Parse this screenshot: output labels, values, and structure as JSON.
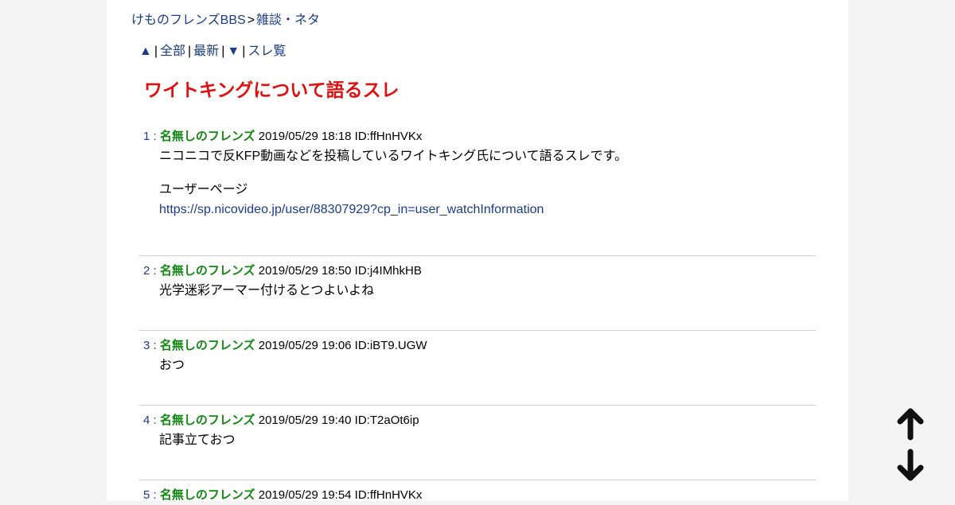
{
  "breadcrumb": {
    "board_link": "けものフレンズBBS",
    "separator": ">",
    "category_link": "雑談・ネタ"
  },
  "nav": {
    "up_arrow": "▲",
    "all": "全部",
    "latest": "最新",
    "down_arrow": "▼",
    "thread_list": "スレ覧",
    "separator": "|"
  },
  "thread_title": "ワイトキングについて語るスレ",
  "posts": [
    {
      "number": "1 :",
      "name": "名無しのフレンズ",
      "meta": "2019/05/29 18:18 ID:ffHnHVKx",
      "body_line1": "ニコニコで反KFP動画などを投稿しているワイトキング氏について語るスレです。",
      "body_line2": "ユーザーページ",
      "body_link": "https://sp.nicovideo.jp/user/88307929?cp_in=user_watchInformation"
    },
    {
      "number": "2 :",
      "name": "名無しのフレンズ",
      "meta": "2019/05/29 18:50 ID:j4IMhkHB",
      "body_line1": "光学迷彩アーマー付けるとつよいよね"
    },
    {
      "number": "3 :",
      "name": "名無しのフレンズ",
      "meta": "2019/05/29 19:06 ID:iBT9.UGW",
      "body_line1": "おつ"
    },
    {
      "number": "4 :",
      "name": "名無しのフレンズ",
      "meta": "2019/05/29 19:40 ID:T2aOt6ip",
      "body_line1": "記事立ておつ"
    },
    {
      "number": "5 :",
      "name": "名無しのフレンズ",
      "meta": "2019/05/29 19:54 ID:ffHnHVKx"
    }
  ],
  "scroll": {
    "up_icon": "arrow-up-icon",
    "down_icon": "arrow-down-icon"
  },
  "colors": {
    "link": "#1a3c8c",
    "title": "#e01010",
    "name": "#118811",
    "background": "#f4f4f4",
    "content_background": "#ffffff"
  }
}
